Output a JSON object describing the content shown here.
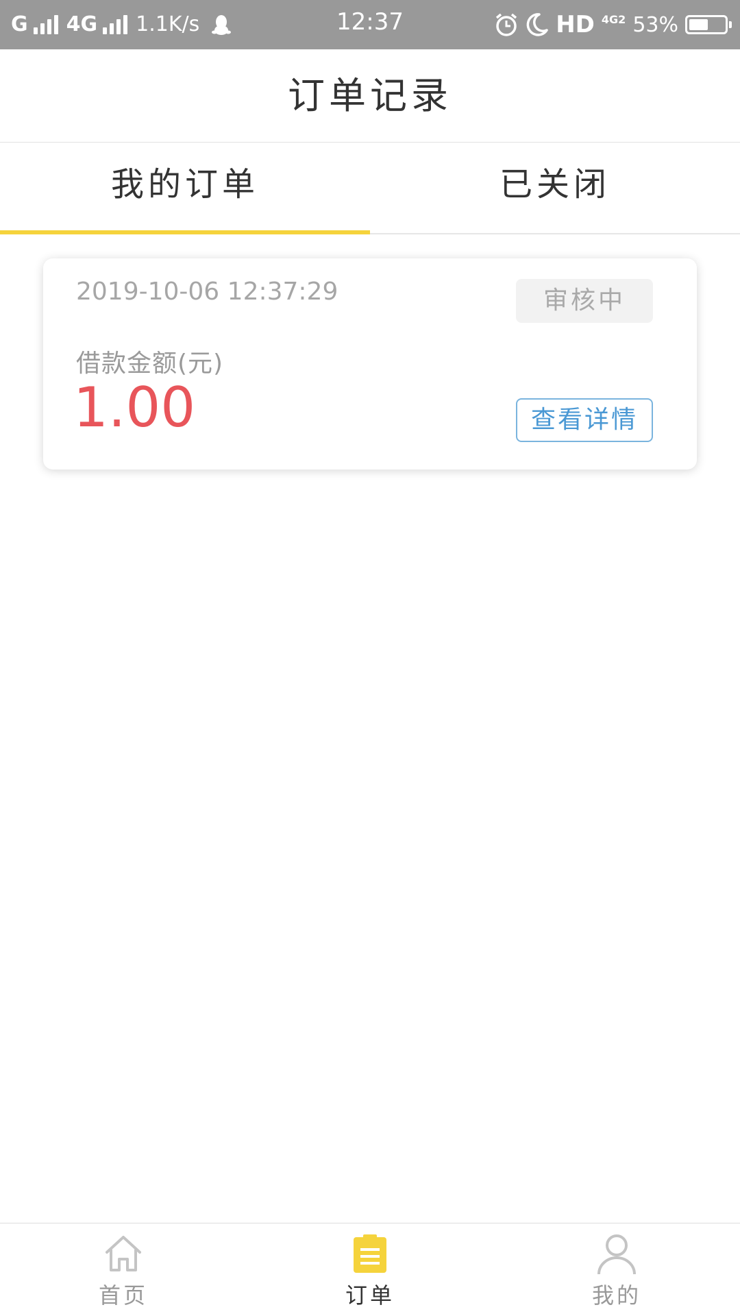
{
  "status_bar": {
    "carrier1": "G",
    "carrier2": "4G",
    "net_speed": "1.1K/s",
    "time": "12:37",
    "hd": "HD",
    "network_sub": "4G2",
    "battery_percent": "53%",
    "battery_level": 0.53,
    "icons": [
      "signal-icon",
      "qq-icon",
      "alarm-icon",
      "moon-icon",
      "battery-icon"
    ]
  },
  "header": {
    "title": "订单记录"
  },
  "tabs": [
    {
      "label": "我的订单",
      "active": true
    },
    {
      "label": "已关闭",
      "active": false
    }
  ],
  "order": {
    "time": "2019-10-06 12:37:29",
    "status": "审核中",
    "amount_label": "借款金额(元)",
    "amount": "1.00",
    "detail_button": "查看详情"
  },
  "bottom_nav": {
    "items": [
      {
        "label": "首页",
        "icon": "home-icon",
        "active": false
      },
      {
        "label": "订单",
        "icon": "clipboard-icon",
        "active": true
      },
      {
        "label": "我的",
        "icon": "user-icon",
        "active": false
      }
    ]
  },
  "colors": {
    "accent": "#f5d33c",
    "amount": "#e8555a",
    "link": "#4a98d4",
    "status_bar": "#999999"
  }
}
